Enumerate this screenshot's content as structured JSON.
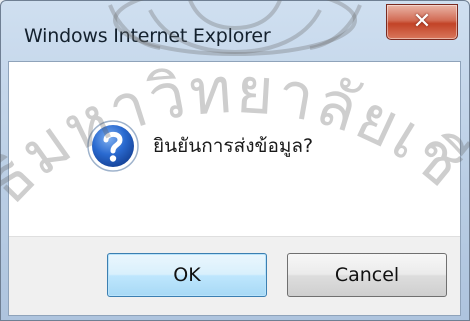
{
  "window": {
    "title": "Windows Internet Explorer",
    "close_glyph": "✕"
  },
  "message": {
    "icon": "question-icon",
    "text": "ยินยันการส่งข้อมูล?"
  },
  "buttons": {
    "ok_label": "OK",
    "cancel_label": "Cancel"
  },
  "watermark": {
    "text": "ลิขสิทธิ์มหาวิทยาลัยเชียงใหม่"
  },
  "colors": {
    "titlebar": "#b9cde4",
    "close_button": "#c24327",
    "icon_blue": "#1f5fbf",
    "default_button_border": "#3c7fb1"
  }
}
